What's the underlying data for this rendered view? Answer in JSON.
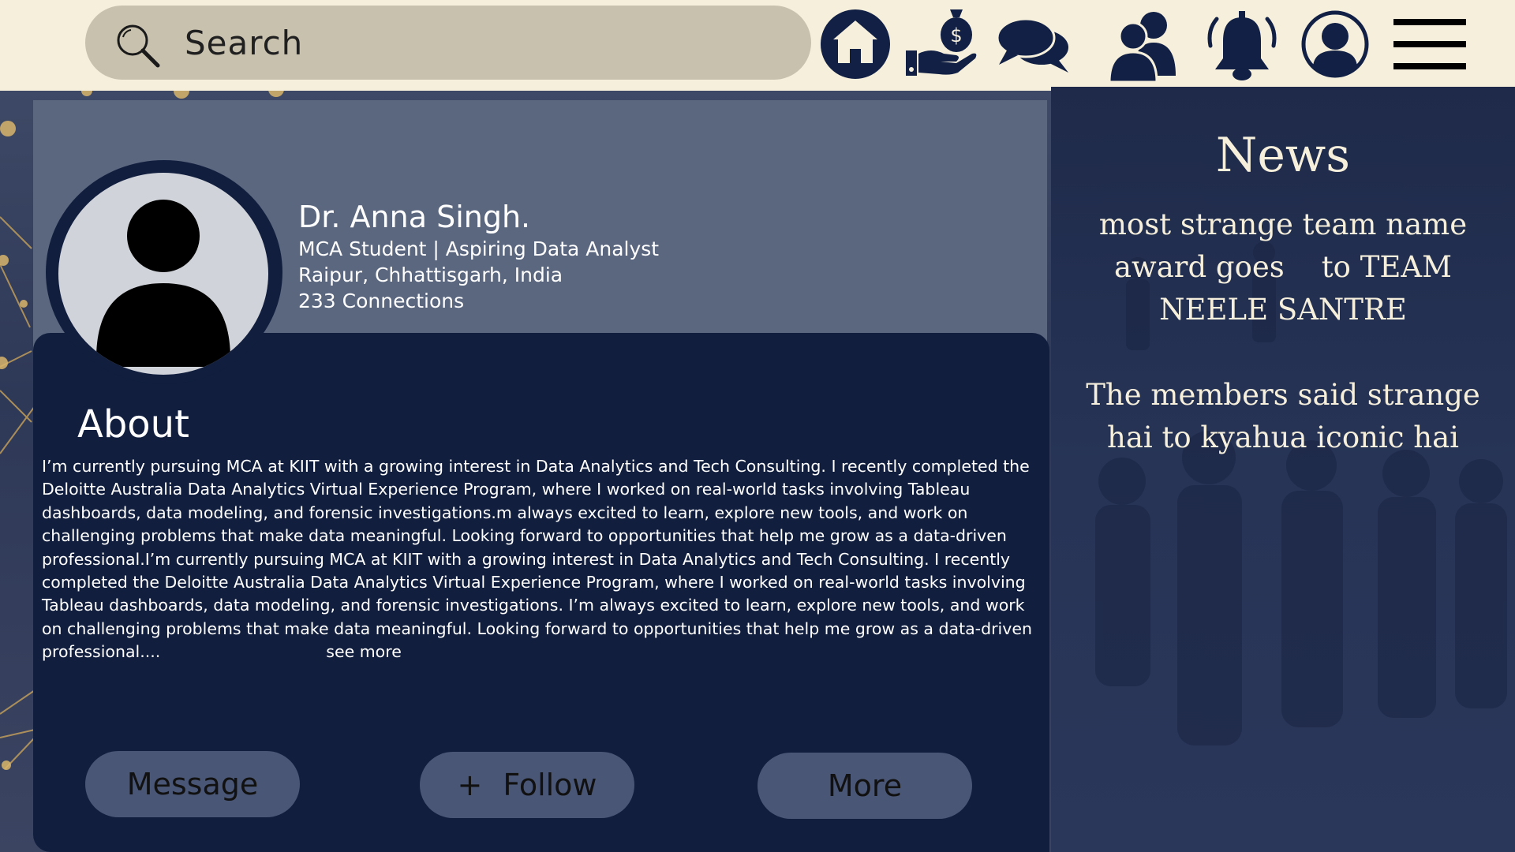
{
  "search": {
    "placeholder": "Search"
  },
  "nav": {
    "icons": [
      "home-icon",
      "money-hand-icon",
      "chat-icon",
      "people-icon",
      "bell-icon",
      "profile-icon",
      "menu-icon"
    ]
  },
  "profile": {
    "name": "Dr. Anna Singh.",
    "headline": "MCA Student | Aspiring Data Analyst",
    "location": "Raipur, Chhattisgarh, India",
    "connections": "233 Connections"
  },
  "about": {
    "heading": "About",
    "text": "I’m currently pursuing MCA at KIIT with a growing interest in Data Analytics and Tech Consulting. I recently completed the Deloitte Australia Data Analytics Virtual Experience Program, where I worked on real-world tasks involving Tableau dashboards, data modeling, and forensic investigations.m always excited to learn, explore new tools, and work on challenging problems that make data meaningful. Looking forward to opportunities that help me grow as a data-driven professional.I’m currently pursuing MCA at KIIT with a growing interest in Data Analytics and Tech Consulting. I recently completed the Deloitte Australia Data Analytics Virtual Experience Program, where I worked on real-world tasks involving Tableau dashboards, data modeling, and forensic investigations. I’m always excited to learn, explore new tools, and work on challenging problems that make data meaningful. Looking forward to opportunities that help me grow as a data-driven professional....",
    "see_more": "see more"
  },
  "actions": {
    "message": "Message",
    "follow_plus": "+",
    "follow": "Follow",
    "more": "More"
  },
  "news": {
    "title": "News",
    "items": [
      "most strange team name award goes    to TEAM NEELE SANTRE",
      "The members said strange hai to kyahua iconic hai"
    ]
  },
  "colors": {
    "topbar": "#f5efdc",
    "search_bg": "#c8c1ae",
    "icon": "#112044",
    "card_header": "#5b667f",
    "card_body": "#111e3e",
    "button": "#4a5675",
    "news_text": "#f5efdc"
  }
}
